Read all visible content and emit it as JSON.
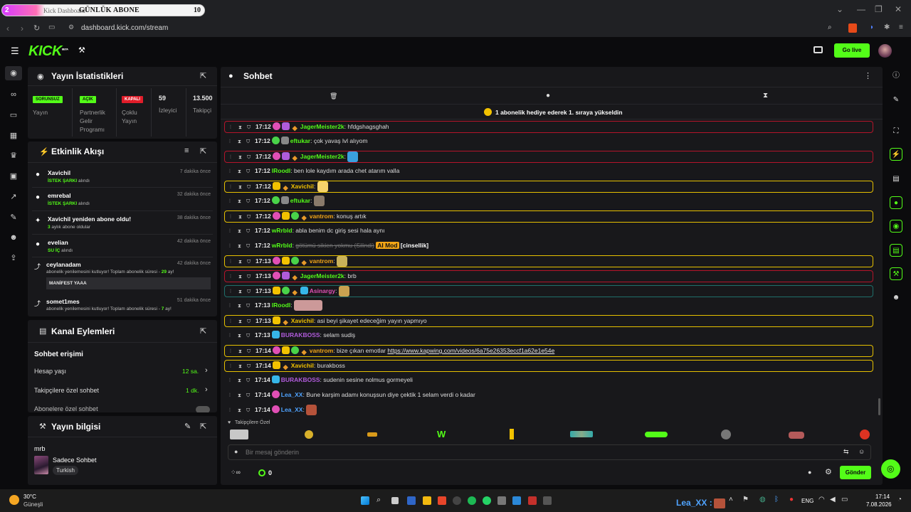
{
  "browser": {
    "tab_title": "GÜNLÜK ABONE",
    "tab_counter": "10",
    "tab_number": "2",
    "tab_ghost_text": "Kick Dashboard",
    "url": "dashboard.kick.com/stream"
  },
  "header": {
    "logo": "KICK",
    "logo_sup": "BETA",
    "go_live_label": "Go live"
  },
  "stream_stats": {
    "title": "Yayın İstatistikleri",
    "items": [
      {
        "badge": "SORUNSUZ",
        "badge_color": "#53fc18",
        "label": "Yayın"
      },
      {
        "badge": "AÇIK",
        "badge_color": "#53fc18",
        "label": "Partnerlik Gelir Programı"
      },
      {
        "badge": "KAPALI",
        "badge_color": "#e11d2a",
        "label": "Çoklu Yayın"
      },
      {
        "value": "59",
        "label": "İzleyici"
      },
      {
        "value": "13.500",
        "label": "Takipçi"
      }
    ]
  },
  "activity": {
    "title": "Etkinlik Akışı",
    "items": [
      {
        "name": "Xavichil",
        "time": "7 dakika önce",
        "highlight": "İSTEK ŞARKI",
        "rest": " alındı"
      },
      {
        "name": "emrebal",
        "time": "32 dakika önce",
        "highlight": "İSTEK ŞARKI",
        "rest": " alındı"
      },
      {
        "name": "Xavichil yeniden abone oldu!",
        "time": "38 dakika önce",
        "highlight": "3",
        "rest": " aylık abone oldular"
      },
      {
        "name": "evelian",
        "time": "42 dakika önce",
        "highlight": "SU İÇ",
        "rest": " alındı"
      },
      {
        "name": "ceylanadam",
        "time": "42 dakika önce",
        "pre": "abonelik yenilemesini kutluyor! Toplam abonelik süresi - ",
        "highlight": "29",
        "rest": " ay!",
        "message": "MANİFEST YAAA"
      },
      {
        "name": "somet1mes",
        "time": "51 dakika önce",
        "pre": "abonelik yenilemesini kutluyor! Toplam abonelik süresi - ",
        "highlight": "7",
        "rest": " ay!"
      }
    ]
  },
  "channel_actions": {
    "title": "Kanal Eylemleri",
    "section": "Sohbet erişimi",
    "rows": [
      {
        "label": "Hesap yaşı",
        "value": "12 sa."
      },
      {
        "label": "Takipçilere özel sohbet",
        "value": "1 dk."
      },
      {
        "label": "Abonelere özel sohbet",
        "value": ""
      }
    ]
  },
  "stream_info": {
    "title": "Yayın bilgisi",
    "stream_title": "mrb",
    "category": "Sadece Sohbet",
    "tag": "Turkish"
  },
  "chat": {
    "title": "Sohbet",
    "pinned": "1 abonelik hediye ederek 1. sıraya yükseldin",
    "followers_only_label": "Takipçilere Özel",
    "input_placeholder": "Bir mesaj gönderin",
    "send_label": "Gönder",
    "points": "0",
    "messages": [
      {
        "time": "17:12",
        "badges": [
          "pink",
          "purple",
          "duck"
        ],
        "user": "JagerMeister2k",
        "color": "#53fc18",
        "text": "hfdgshagsghah",
        "border": "red"
      },
      {
        "time": "17:12",
        "badges": [
          "green",
          "gray"
        ],
        "user": "eftukar",
        "color": "#53fc18",
        "text": "çok yavaş lvl alıyom",
        "border": ""
      },
      {
        "time": "17:12",
        "badges": [
          "pink",
          "purple",
          "duck"
        ],
        "user": "JagerMeister2k",
        "color": "#53fc18",
        "text": "",
        "emote": "#3aa0e0",
        "border": "red"
      },
      {
        "time": "17:12",
        "badges": [],
        "user": "lRoodl",
        "color": "#53fc18",
        "text": "ben lole kaydım arada chet atarım valla",
        "border": ""
      },
      {
        "time": "17:12",
        "badges": [
          "gold",
          "duck"
        ],
        "user": "Xavichil",
        "color": "#f2c200",
        "text": "",
        "emote": "#f5d36b",
        "border": "yellow"
      },
      {
        "time": "17:12",
        "badges": [
          "green",
          "gray"
        ],
        "user": "eftukar",
        "color": "#53fc18",
        "text": "",
        "emote": "#8a7a6a",
        "border": ""
      },
      {
        "time": "17:12",
        "badges": [
          "pink",
          "gold",
          "green",
          "duck"
        ],
        "user": "vantrom",
        "color": "#f2a516",
        "text": "konuş artık",
        "border": "yellow"
      },
      {
        "time": "17:12",
        "badges": [],
        "user": "wRrbld",
        "color": "#53fc18",
        "text": "abla benim dc giriş sesi hala aynı",
        "border": ""
      },
      {
        "time": "17:12",
        "badges": [],
        "user": "wRrbld",
        "color": "#53fc18",
        "text": "",
        "deleted": "götümü sikien yokmu (Silindi)",
        "automod": "AI Mod",
        "tail": "[cinsellik]",
        "border": ""
      },
      {
        "time": "17:13",
        "badges": [
          "pink",
          "gold",
          "green",
          "duck"
        ],
        "user": "vantrom",
        "color": "#f2a516",
        "text": "",
        "emote": "#c9b25a",
        "border": "yellow"
      },
      {
        "time": "17:13",
        "badges": [
          "pink",
          "purple",
          "duck"
        ],
        "user": "JagerMeister2k",
        "color": "#53fc18",
        "text": "brb",
        "border": "red"
      },
      {
        "time": "17:13",
        "badges": [
          "gold",
          "green",
          "duck",
          "cyan"
        ],
        "user": "Asinargy",
        "color": "#e14fb5",
        "text": "",
        "emote": "#caa250",
        "border": "teal"
      },
      {
        "time": "17:13",
        "badges": [],
        "user": "lRoodl",
        "color": "#53fc18",
        "text": "",
        "emote": "#c99",
        "wide": true,
        "border": ""
      },
      {
        "time": "17:13",
        "badges": [
          "gold",
          "duck"
        ],
        "user": "Xavichil",
        "color": "#f2c200",
        "text": "asi beyi şikayet edeceğim yayın yapmıyo",
        "border": "yellow"
      },
      {
        "time": "17:13",
        "badges": [
          "cyan"
        ],
        "user": "BURAKBOSS",
        "color": "#b05bdb",
        "text": "selam sudiş",
        "border": ""
      },
      {
        "time": "17:14",
        "badges": [
          "pink",
          "gold",
          "green",
          "duck"
        ],
        "user": "vantrom",
        "color": "#f2a516",
        "text": "bize çıkan emotlar ",
        "link": "https://www.kapwing.com/videos/6a75e26353eccf1a62e1e54e",
        "border": "yellow"
      },
      {
        "time": "17:14",
        "badges": [
          "gold",
          "duck"
        ],
        "user": "Xavichil",
        "color": "#f2c200",
        "text": "burakboss",
        "border": "yellow"
      },
      {
        "time": "17:14",
        "badges": [
          "cyan"
        ],
        "user": "BURAKBOSS",
        "color": "#b05bdb",
        "text": "sudenin sesine nolmus gormeyeli",
        "border": ""
      },
      {
        "time": "17:14",
        "badges": [
          "pink"
        ],
        "user": "Lea_XX",
        "color": "#4fa3ff",
        "text": "Bune karşim adamı konuşsun diye çektik 1 selam verdi o kadar",
        "border": ""
      },
      {
        "time": "17:14",
        "badges": [
          "pink"
        ],
        "user": "Lea_XX",
        "color": "#4fa3ff",
        "text": "",
        "emote": "#b5523a",
        "border": ""
      }
    ]
  },
  "taskbar": {
    "weather_temp": "30°C",
    "weather_desc": "Güneşli",
    "overlay_user": "Lea_XX :",
    "language": "ENG",
    "time": "17:14",
    "date": "7.08.2026"
  }
}
